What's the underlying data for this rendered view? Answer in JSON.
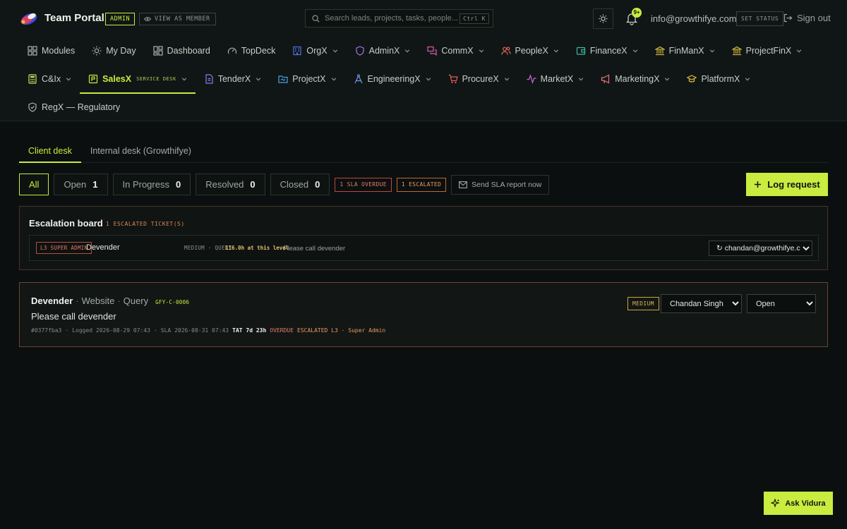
{
  "header": {
    "brand": "Team Portal",
    "admin_badge": "ADMIN",
    "view_as_member": "VIEW AS MEMBER",
    "search_placeholder": "Search leads, projects, tasks, people...",
    "search_shortcut": "Ctrl K",
    "notification_count": "9+",
    "email": "info@growthifye.com",
    "set_status": "SET STATUS",
    "sign_out": "Sign out"
  },
  "nav": {
    "row1": [
      {
        "label": "Modules",
        "icon": "grid-icon",
        "dropdown": false
      },
      {
        "label": "My Day",
        "icon": "sun-icon",
        "dropdown": false
      },
      {
        "label": "Dashboard",
        "icon": "dashboard-icon",
        "dropdown": false
      },
      {
        "label": "TopDeck",
        "icon": "gauge-icon",
        "dropdown": false
      },
      {
        "label": "OrgX",
        "icon": "building-icon",
        "dropdown": true
      },
      {
        "label": "AdminX",
        "icon": "shield-icon",
        "dropdown": true
      },
      {
        "label": "CommX",
        "icon": "chat-icon",
        "dropdown": true
      },
      {
        "label": "PeopleX",
        "icon": "people-icon",
        "dropdown": true
      },
      {
        "label": "FinanceX",
        "icon": "wallet-icon",
        "dropdown": true
      },
      {
        "label": "FinManX",
        "icon": "bank-icon",
        "dropdown": true
      },
      {
        "label": "ProjectFinX",
        "icon": "bank-icon",
        "dropdown": true
      }
    ],
    "row2": [
      {
        "label": "C&Ix",
        "icon": "calculator-icon",
        "dropdown": true
      },
      {
        "label": "SalesX",
        "icon": "sales-icon",
        "dropdown": true,
        "sub": "SERVICE DESK",
        "active": true
      },
      {
        "label": "TenderX",
        "icon": "file-icon",
        "dropdown": true
      },
      {
        "label": "ProjectX",
        "icon": "folder-icon",
        "dropdown": true
      },
      {
        "label": "EngineeringX",
        "icon": "compass-icon",
        "dropdown": true
      },
      {
        "label": "ProcureX",
        "icon": "cart-icon",
        "dropdown": true
      },
      {
        "label": "MarketX",
        "icon": "activity-icon",
        "dropdown": true
      },
      {
        "label": "MarketingX",
        "icon": "megaphone-icon",
        "dropdown": true
      },
      {
        "label": "PlatformX",
        "icon": "graduation-icon",
        "dropdown": true
      }
    ],
    "row3": [
      {
        "label": "RegX — Regulatory",
        "icon": "shield-check-icon",
        "dropdown": false
      }
    ]
  },
  "desk_tabs": [
    "Client desk",
    "Internal desk (Growthifye)"
  ],
  "filters": {
    "all": "All",
    "status": [
      {
        "label": "Open",
        "count": "1"
      },
      {
        "label": "In Progress",
        "count": "0"
      },
      {
        "label": "Resolved",
        "count": "0"
      },
      {
        "label": "Closed",
        "count": "0"
      }
    ],
    "sla_overdue": "1 SLA OVERDUE",
    "escalated": "1 ESCALATED",
    "send_sla": "Send SLA report now"
  },
  "log_request": "Log request",
  "escalation_board": {
    "title": "Escalation board",
    "count": "1 ESCALATED TICKET(S)",
    "items": [
      {
        "level": "L3 SUPER ADMIN",
        "name": "Devender",
        "meta": "MEDIUM · QUERY",
        "hours": "116.0h at this level",
        "note": "Please call devender",
        "assignee": "↻ chandan@growthifye.com"
      }
    ]
  },
  "ticket": {
    "client": "Devender",
    "channel": "Website",
    "type": "Query",
    "code": "GFY-C-0006",
    "subject": "Please call devender",
    "hash": "#0377fba3",
    "logged": "Logged 2026-08-29 07:43",
    "sla": "SLA 2026-08-31 07:43",
    "tat": "TAT 7d 23h",
    "overdue": "OVERDUE",
    "escalation": "ESCALATED L3 · Super Admin",
    "priority": "MEDIUM",
    "assignee": "Chandan Singh",
    "status": "Open"
  },
  "ask_button": "Ask Vidura",
  "colors": {
    "accent": "#c8ec3f",
    "background": "#0c0f0f",
    "danger": "#e27b69",
    "warning": "#e89a60"
  }
}
